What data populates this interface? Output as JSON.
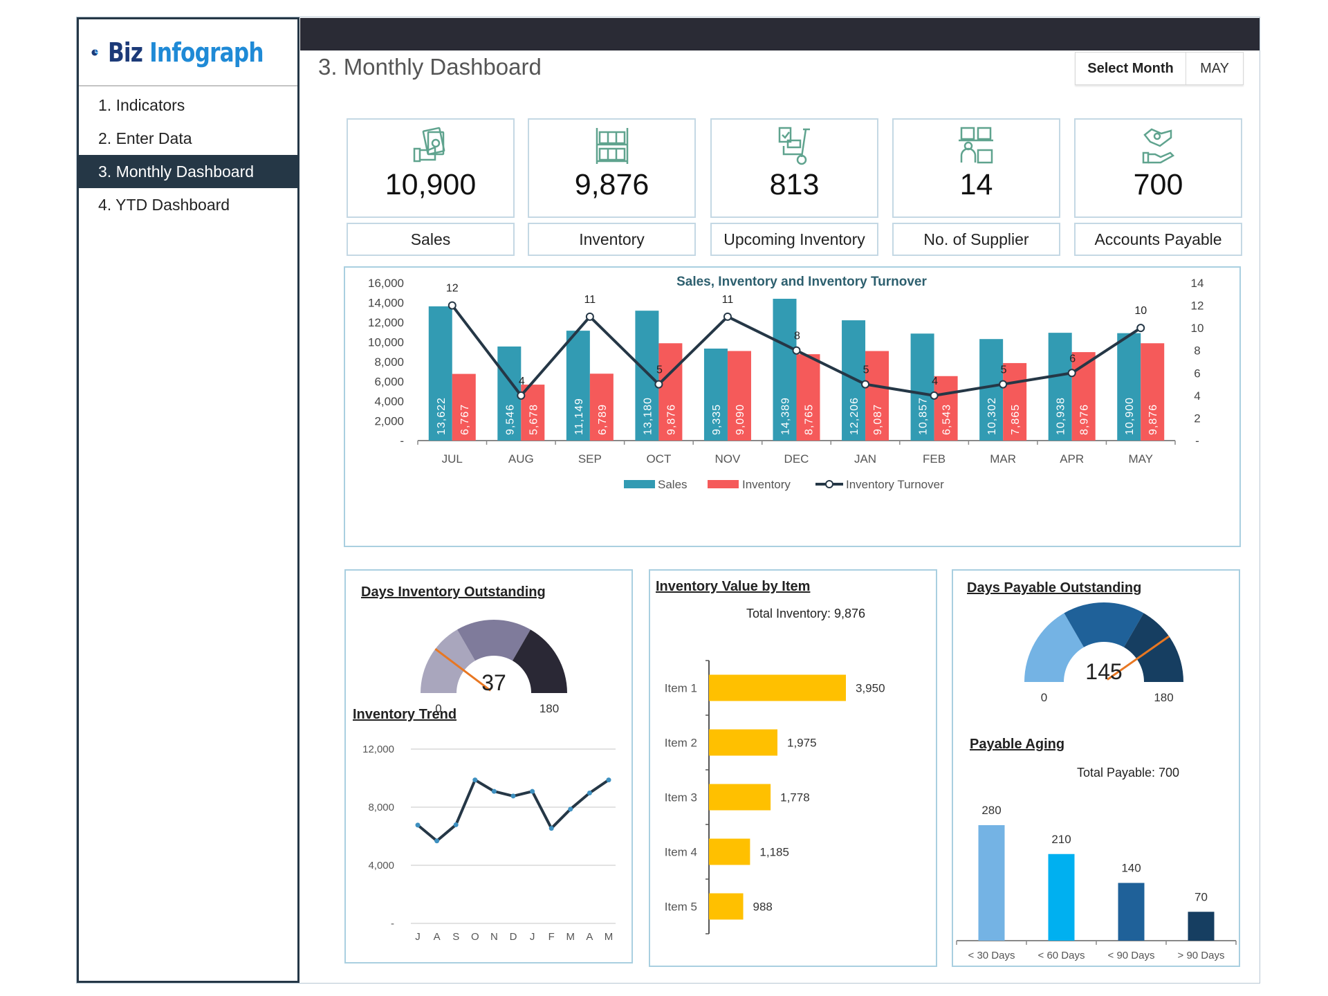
{
  "app": {
    "logo_part1": "Biz",
    "logo_part2": "Infograph"
  },
  "sidebar": {
    "items": [
      {
        "label": "1. Indicators",
        "active": false
      },
      {
        "label": "2. Enter Data",
        "active": false
      },
      {
        "label": "3. Monthly Dashboard",
        "active": true
      },
      {
        "label": "4. YTD Dashboard",
        "active": false
      }
    ]
  },
  "header": {
    "title": "3. Monthly Dashboard",
    "select_month_label": "Select Month",
    "selected_month": "MAY"
  },
  "kpis": [
    {
      "icon": "money-hand-icon",
      "value": "10,900",
      "label": "Sales"
    },
    {
      "icon": "warehouse-shelf-icon",
      "value": "9,876",
      "label": "Inventory"
    },
    {
      "icon": "hand-truck-icon",
      "value": "813",
      "label": "Upcoming Inventory"
    },
    {
      "icon": "supplier-boxes-icon",
      "value": "14",
      "label": "No. of Supplier"
    },
    {
      "icon": "handshake-payment-icon",
      "value": "700",
      "label": "Accounts Payable"
    }
  ],
  "colors": {
    "sales": "#329bb3",
    "inventory": "#f55a5a",
    "turnover_line": "#253746",
    "icon": "#5fa38e",
    "gauge_dio": [
      "#a9a6bd",
      "#7f7b9b",
      "#2a2835"
    ],
    "gauge_dpo": [
      "#74b3e4",
      "#1f6199",
      "#163e61"
    ],
    "needle": "#e87722",
    "item_bar": "#ffc000",
    "aging": [
      "#74b3e4",
      "#00b0f0",
      "#1f6199",
      "#163e61"
    ]
  },
  "chart_data": [
    {
      "id": "main",
      "type": "bar",
      "title": "Sales, Inventory and Inventory Turnover",
      "categories": [
        "JUL",
        "AUG",
        "SEP",
        "OCT",
        "NOV",
        "DEC",
        "JAN",
        "FEB",
        "MAR",
        "APR",
        "MAY"
      ],
      "series": [
        {
          "name": "Sales",
          "type": "bar",
          "axis": "left",
          "values": [
            13622,
            9546,
            11149,
            13180,
            9335,
            14389,
            12206,
            10857,
            10302,
            10938,
            10900
          ],
          "labels": [
            "13,622",
            "9,546",
            "11,149",
            "13,180",
            "9,335",
            "14,389",
            "12,206",
            "10,857",
            "10,302",
            "10,938",
            "10,900"
          ]
        },
        {
          "name": "Inventory",
          "type": "bar",
          "axis": "left",
          "values": [
            6767,
            5678,
            6789,
            9876,
            9090,
            8765,
            9087,
            6543,
            7865,
            8976,
            9876
          ],
          "labels": [
            "6,767",
            "5,678",
            "6,789",
            "9,876",
            "9,090",
            "8,765",
            "9,087",
            "6,543",
            "7,865",
            "8,976",
            "9,876"
          ]
        },
        {
          "name": "Inventory Turnover",
          "type": "line",
          "axis": "right",
          "values": [
            12,
            4,
            11,
            5,
            11,
            8,
            5,
            4,
            5,
            6,
            10
          ],
          "labels": [
            "12",
            "4",
            "11",
            "5",
            "11",
            "8",
            "5",
            "4",
            "5",
            "6",
            "10"
          ]
        }
      ],
      "y_left": {
        "min": 0,
        "max": 16000,
        "ticks": [
          "-",
          "2,000",
          "4,000",
          "6,000",
          "8,000",
          "10,000",
          "12,000",
          "14,000",
          "16,000"
        ]
      },
      "y_right": {
        "min": 0,
        "max": 14,
        "ticks": [
          "-",
          "2",
          "4",
          "6",
          "8",
          "10",
          "12",
          "14"
        ]
      },
      "legend": [
        "Sales",
        "Inventory",
        "Inventory Turnover"
      ],
      "legend_position": "bottom"
    },
    {
      "id": "dio",
      "type": "gauge",
      "title": "Days Inventory Outstanding",
      "value": 37,
      "value_label": "37",
      "min": 0,
      "max": 180,
      "min_label": "0",
      "max_label": "180",
      "bands": [
        60,
        120,
        180
      ]
    },
    {
      "id": "trend",
      "type": "line",
      "title": "Inventory Trend",
      "categories": [
        "J",
        "A",
        "S",
        "O",
        "N",
        "D",
        "J",
        "F",
        "M",
        "A",
        "M"
      ],
      "values": [
        6767,
        5678,
        6789,
        9876,
        9090,
        8765,
        9087,
        6543,
        7865,
        8976,
        9876
      ],
      "ylim": [
        0,
        12000
      ],
      "yticks": [
        "-",
        "4,000",
        "8,000",
        "12,000"
      ],
      "grid": true
    },
    {
      "id": "items",
      "type": "bar",
      "orientation": "horizontal",
      "title": "Inventory Value by Item",
      "subtitle": "Total Inventory: 9,876",
      "categories": [
        "Item 1",
        "Item 2",
        "Item 3",
        "Item 4",
        "Item 5"
      ],
      "values": [
        3950,
        1975,
        1778,
        1185,
        988
      ],
      "labels": [
        "3,950",
        "1,975",
        "1,778",
        "1,185",
        "988"
      ],
      "xlim": [
        0,
        5000
      ]
    },
    {
      "id": "dpo",
      "type": "gauge",
      "title": "Days Payable Outstanding",
      "value": 145,
      "value_label": "145",
      "min": 0,
      "max": 180,
      "min_label": "0",
      "max_label": "180",
      "bands": [
        60,
        120,
        180
      ]
    },
    {
      "id": "aging",
      "type": "bar",
      "title": "Payable Aging",
      "subtitle": "Total Payable: 700",
      "categories": [
        "< 30 Days",
        "< 60 Days",
        "< 90 Days",
        "> 90 Days"
      ],
      "values": [
        280,
        210,
        140,
        70
      ],
      "labels": [
        "280",
        "210",
        "140",
        "70"
      ],
      "ylim": [
        0,
        350
      ]
    }
  ]
}
